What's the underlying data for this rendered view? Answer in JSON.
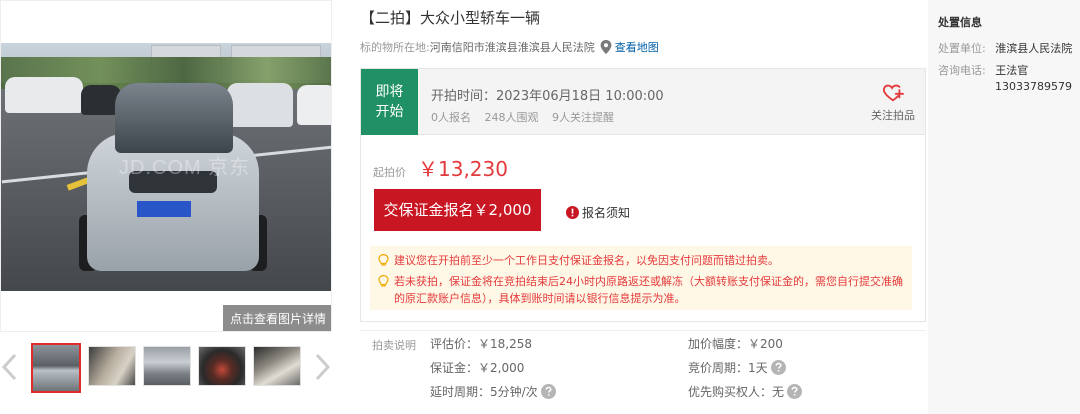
{
  "gallery": {
    "watermark": "JD.COM 京东",
    "detail_button": "点击查看图片详情",
    "thumbnail_count": 5
  },
  "lot": {
    "title": "【二拍】大众小型轿车一辆",
    "location_label": "标的物所在地:",
    "location_value": "河南信阳市淮滨县淮滨县人民法院",
    "map_link": "查看地图"
  },
  "status": {
    "badge_line1": "即将",
    "badge_line2": "开始",
    "start_time": "开拍时间：2023年06月18日 10:00:00",
    "signups": "0人报名",
    "watchers": "248人围观",
    "reminders": "9人关注提醒",
    "follow_label": "关注拍品"
  },
  "price": {
    "label": "起拍价",
    "value": "￥13,230"
  },
  "actions": {
    "deposit_button": "交保证金报名￥2,000",
    "notice_link": "报名须知"
  },
  "tips": [
    "建议您在开拍前至少一个工作日支付保证金报名，以免因支付问题而错过拍卖。",
    "若未获拍，保证金将在竞拍结束后24小时内原路返还或解冻（大额转账支付保证金的，需您自行提交准确的原汇款账户信息），具体到账时间请以银行信息提示为准。"
  ],
  "auction_info": {
    "heading": "拍卖说明",
    "appraisal": "评估价：￥18,258",
    "increment": "加价幅度：￥200",
    "deposit": "保证金：￥2,000",
    "cycle": "竞价周期：1天",
    "delay": "延时周期：5分钟/次",
    "priority": "优先购买权人：无"
  },
  "disposal": {
    "title": "处置信息",
    "unit_label": "处置单位:",
    "unit_value": "淮滨县人民法院",
    "contact_label": "咨询电话:",
    "contact_name": "王法官",
    "contact_phone": "13033789579"
  },
  "colors": {
    "brand_red": "#c81623",
    "price_red": "#e4393c",
    "status_green": "#1f9164",
    "link_blue": "#005ea7",
    "tip_bg": "#fff8e6"
  }
}
